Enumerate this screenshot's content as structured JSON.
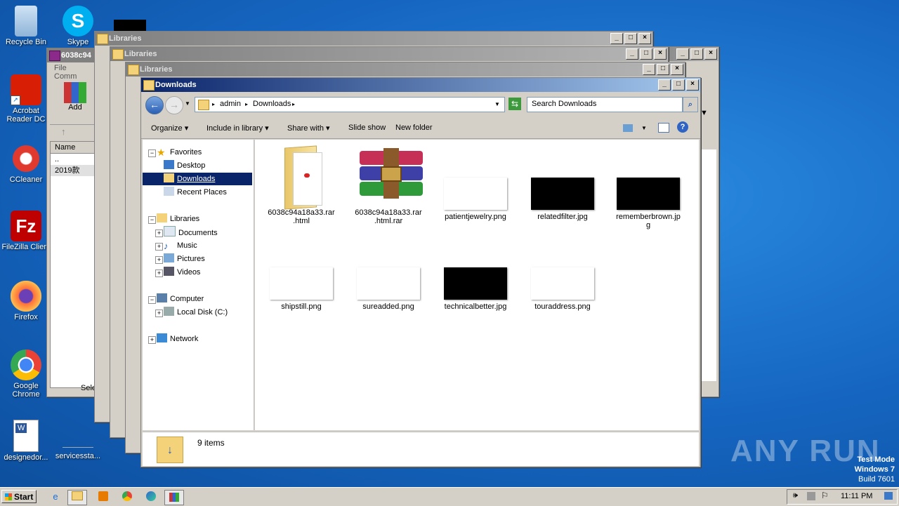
{
  "desktop": {
    "icons": [
      {
        "label": "Recycle Bin"
      },
      {
        "label": "Skype"
      },
      {
        "label": "Acrobat Reader DC"
      },
      {
        "label": "CCleaner"
      },
      {
        "label": "FileZilla Client"
      },
      {
        "label": "Firefox"
      },
      {
        "label": "Google Chrome"
      },
      {
        "label": "designedor..."
      },
      {
        "label": "servicessta..."
      }
    ]
  },
  "bg_windows": {
    "winrar_title": "6038c94",
    "winrar_menu": [
      "File",
      "Comm"
    ],
    "winrar_add": "Add",
    "winrar_col_name": "Name",
    "winrar_row1": "..",
    "winrar_row2": "2019款",
    "winrar_status": "Sele",
    "libraries_title": "Libraries"
  },
  "explorer": {
    "title": "Downloads",
    "breadcrumb": [
      "admin",
      "Downloads"
    ],
    "search_placeholder": "Search Downloads",
    "commands": [
      "Organize",
      "Include in library",
      "Share with",
      "Slide show",
      "New folder"
    ],
    "nav": {
      "favorites": "Favorites",
      "favorites_items": [
        "Desktop",
        "Downloads",
        "Recent Places"
      ],
      "libraries": "Libraries",
      "libraries_items": [
        "Documents",
        "Music",
        "Pictures",
        "Videos"
      ],
      "computer": "Computer",
      "computer_items": [
        "Local Disk (C:)"
      ],
      "network": "Network"
    },
    "files": [
      {
        "name": "6038c94a18a33.rar\n.html"
      },
      {
        "name": "6038c94a18a33.rar\n.html.rar"
      },
      {
        "name": "patientjewelry.png"
      },
      {
        "name": "relatedfilter.jpg"
      },
      {
        "name": "rememberbrown.jp\ng"
      },
      {
        "name": "shipstill.png"
      },
      {
        "name": "sureadded.png"
      },
      {
        "name": "technicalbetter.jpg"
      },
      {
        "name": "touraddress.png"
      }
    ],
    "status_count": "9 items"
  },
  "taskbar": {
    "start": "Start",
    "time": "11:11 PM"
  },
  "watermark": "ANY RUN",
  "test_mode": [
    "Test Mode",
    "Windows 7",
    "Build 7601"
  ]
}
